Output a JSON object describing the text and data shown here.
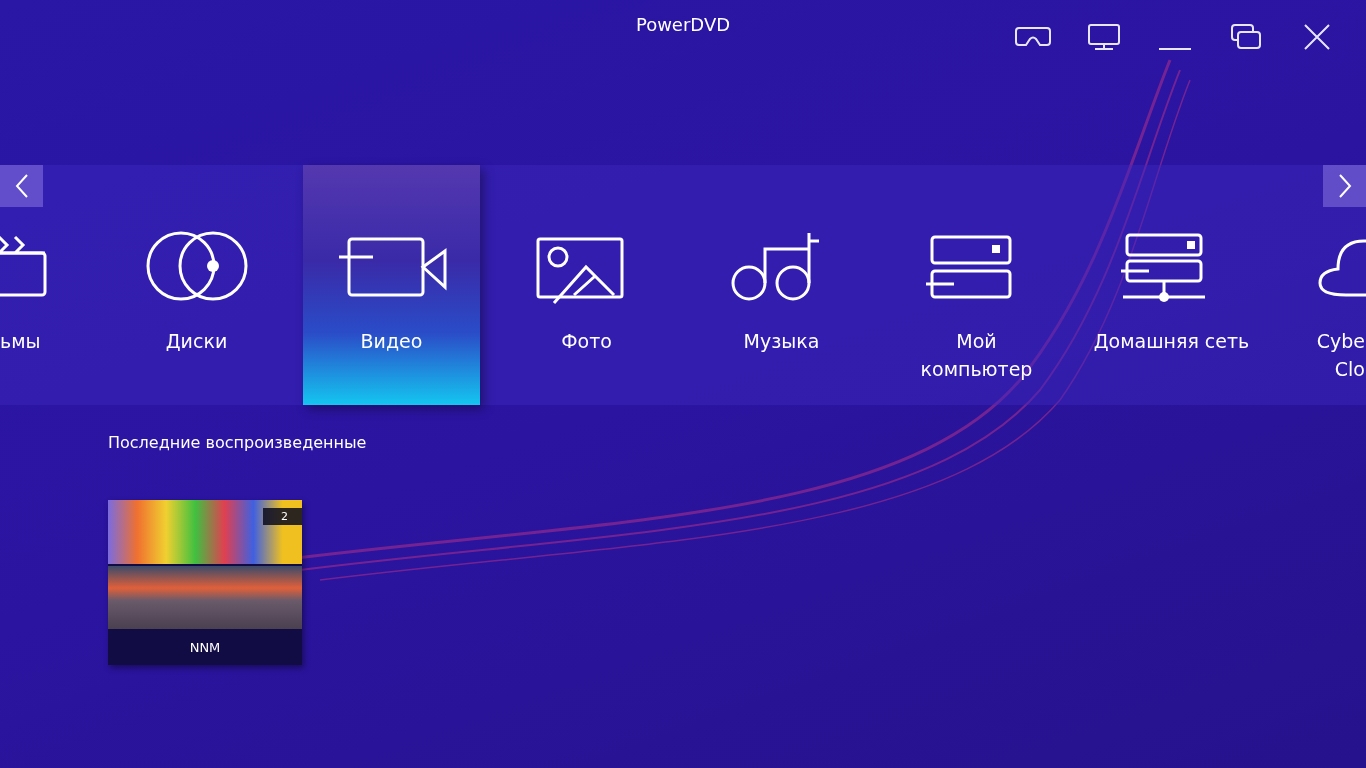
{
  "window": {
    "title": "PowerDVD"
  },
  "categories": [
    {
      "lines": [
        "ьмы"
      ],
      "kind": "clipped-left",
      "selected": false
    },
    {
      "lines": [
        "Диски"
      ],
      "kind": "full",
      "selected": false
    },
    {
      "lines": [
        "Видео"
      ],
      "kind": "full",
      "selected": true
    },
    {
      "lines": [
        "Фото"
      ],
      "kind": "full",
      "selected": false
    },
    {
      "lines": [
        "Музыка"
      ],
      "kind": "full",
      "selected": false
    },
    {
      "lines": [
        "Мой",
        "компьютер"
      ],
      "kind": "full",
      "selected": false
    },
    {
      "lines": [
        "Домашняя сеть"
      ],
      "kind": "full",
      "selected": false
    },
    {
      "lines": [
        "Cybe",
        "Clo"
      ],
      "kind": "clipped-right",
      "selected": false
    }
  ],
  "recent": {
    "heading": "Последние воспроизведенные",
    "items": [
      {
        "title": "NNM",
        "count": "2"
      }
    ]
  }
}
